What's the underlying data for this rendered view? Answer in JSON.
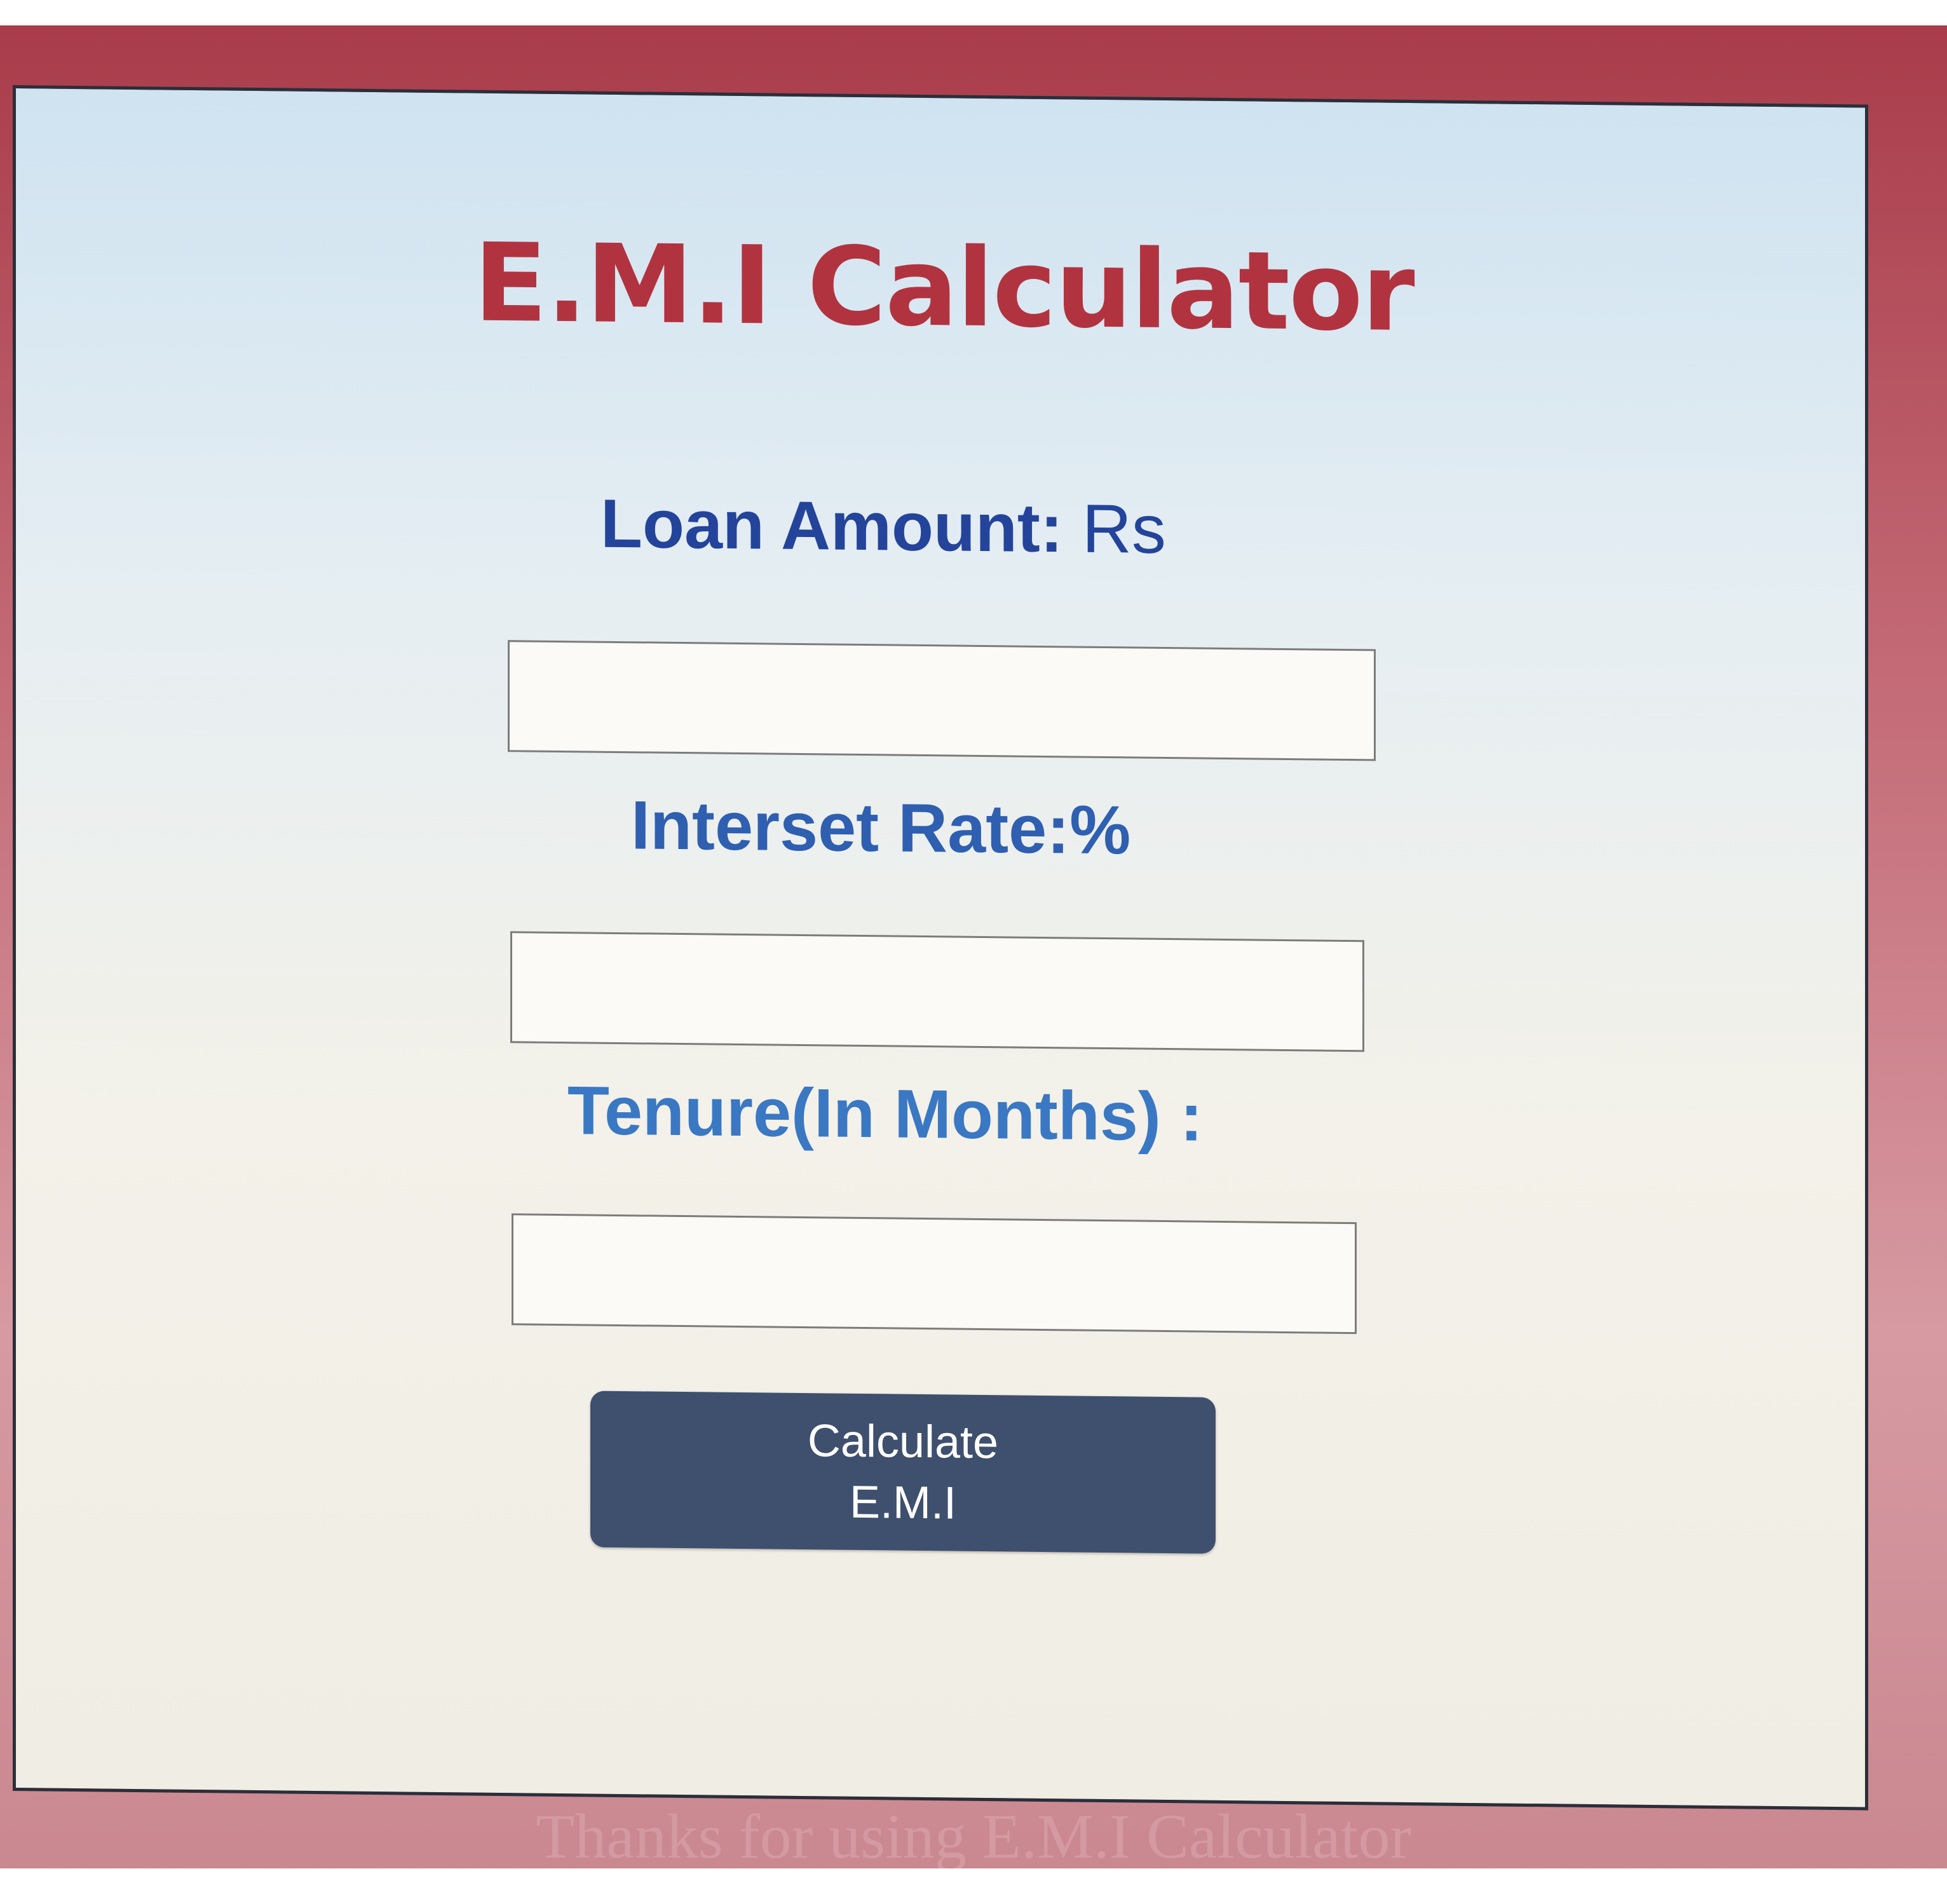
{
  "app": {
    "title": "E.M.I Calculator"
  },
  "form": {
    "loan_amount": {
      "label": "Loan Amount:",
      "unit": "Rs",
      "value": ""
    },
    "interest_rate": {
      "label": "Interset Rate:%",
      "value": ""
    },
    "tenure": {
      "label": "Tenure(In Months) :",
      "value": ""
    }
  },
  "calculate_button": {
    "line1": "Calculate",
    "line2": "E.M.I"
  },
  "footer": {
    "text": "Thanks for using E.M.I Calculator"
  },
  "colors": {
    "title": "#b23340",
    "loan_label": "#23449a",
    "rate_label": "#2f5fb0",
    "tenure_label": "#3a78c3",
    "button_bg": "#3f4f6e",
    "frame": "#c36a76"
  }
}
